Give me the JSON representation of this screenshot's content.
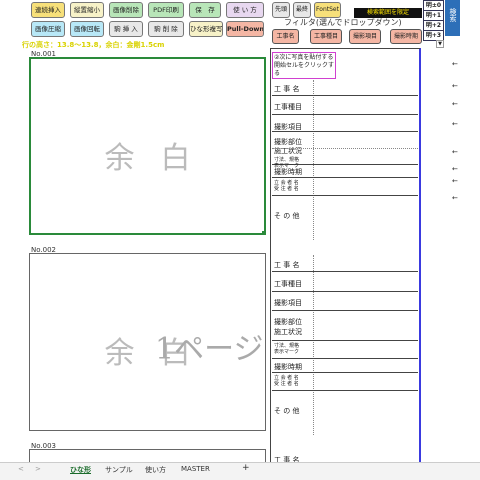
{
  "toolbar": {
    "row1": [
      "連続挿入",
      "縦置縮小",
      "画像削除",
      "PDF印刷",
      "保　存",
      "使 い 方"
    ],
    "row2": [
      "画像圧縮",
      "画像回転",
      "駒 挿 入",
      "駒 削 除",
      "ひな形複写",
      "Pull-Down"
    ],
    "small": [
      "先頭",
      "最終",
      "FontSet"
    ],
    "filter_label": "フィルタ(選んでドロップダウン)",
    "filter_badge": "検索範囲を限定",
    "filter_buttons": [
      "工事名",
      "工事種目",
      "撮影項目",
      "撮影時期"
    ],
    "brightness": [
      "明±0",
      "明+1",
      "明+2",
      "明+3"
    ],
    "search_label": "検索"
  },
  "info": "行の高さ：13.8～13.8，余白：金剛1.5cm",
  "page": {
    "photo_blocks": [
      {
        "no": "No.001",
        "placeholder": "余白"
      },
      {
        "no": "No.002",
        "placeholder": "余白"
      },
      {
        "no": "No.003",
        "placeholder": ""
      }
    ],
    "overlay_text": "1ページ",
    "note": "②次に写真を貼付する開始セルをクリックする",
    "fields": {
      "koji_mei": "工 事 名",
      "koji_shumoku": "工事種目",
      "satsuei_komoku": "撮影項目",
      "satsuei_bui": "撮影部位",
      "seko_jokyo": "施工状況",
      "sunpo1": "寸法、規格",
      "sunpo2": "表示マーク",
      "satsuei_jiki": "撮影時期",
      "tachiai": "立 会 者 名",
      "jutaku": "受 注 者 名",
      "sonota": "そ の 他"
    }
  },
  "sheet_tabs": {
    "nav_prev": "<",
    "nav_next": ">",
    "tabs": [
      "ひな形",
      "サンプル",
      "使い方",
      "MASTER"
    ],
    "add": "+"
  },
  "colors": {
    "accent_blue": "#2d6fb8",
    "toolbar_bg": "#c9e5c9",
    "info_text": "#d9d200",
    "frame_line": "#3a3ae0"
  }
}
